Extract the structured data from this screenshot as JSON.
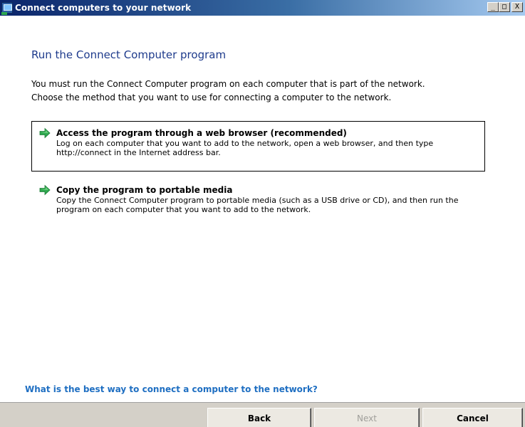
{
  "window": {
    "title": "Connect computers to your network",
    "controls": {
      "minimize": "_",
      "maximize": "□",
      "close": "X"
    }
  },
  "page": {
    "heading": "Run the Connect Computer program",
    "intro_line1": "You must run the Connect Computer program on each computer that is part of the network.",
    "intro_line2": "Choose the method that you want to use for connecting a computer to the network."
  },
  "options": [
    {
      "title": "Access the program through a web browser (recommended)",
      "desc_line1": "Log on each computer that you want to add to the network, open a web browser, and then type",
      "desc_line2": "http://connect in the Internet address bar.",
      "icon": "green-arrow-icon"
    },
    {
      "title": "Copy the program to portable media",
      "desc_line1": "Copy the Connect Computer program to portable media (such as a USB drive or CD), and then run the",
      "desc_line2": "program on each computer that you want to add to the network.",
      "icon": "green-arrow-icon"
    }
  ],
  "help_link": "What is the best way to connect a computer to the network?",
  "buttons": {
    "back": "Back",
    "next": "Next",
    "cancel": "Cancel"
  },
  "colors": {
    "heading": "#1e3b8c",
    "link": "#1f6fc2",
    "arrow": "#2fa84f"
  }
}
